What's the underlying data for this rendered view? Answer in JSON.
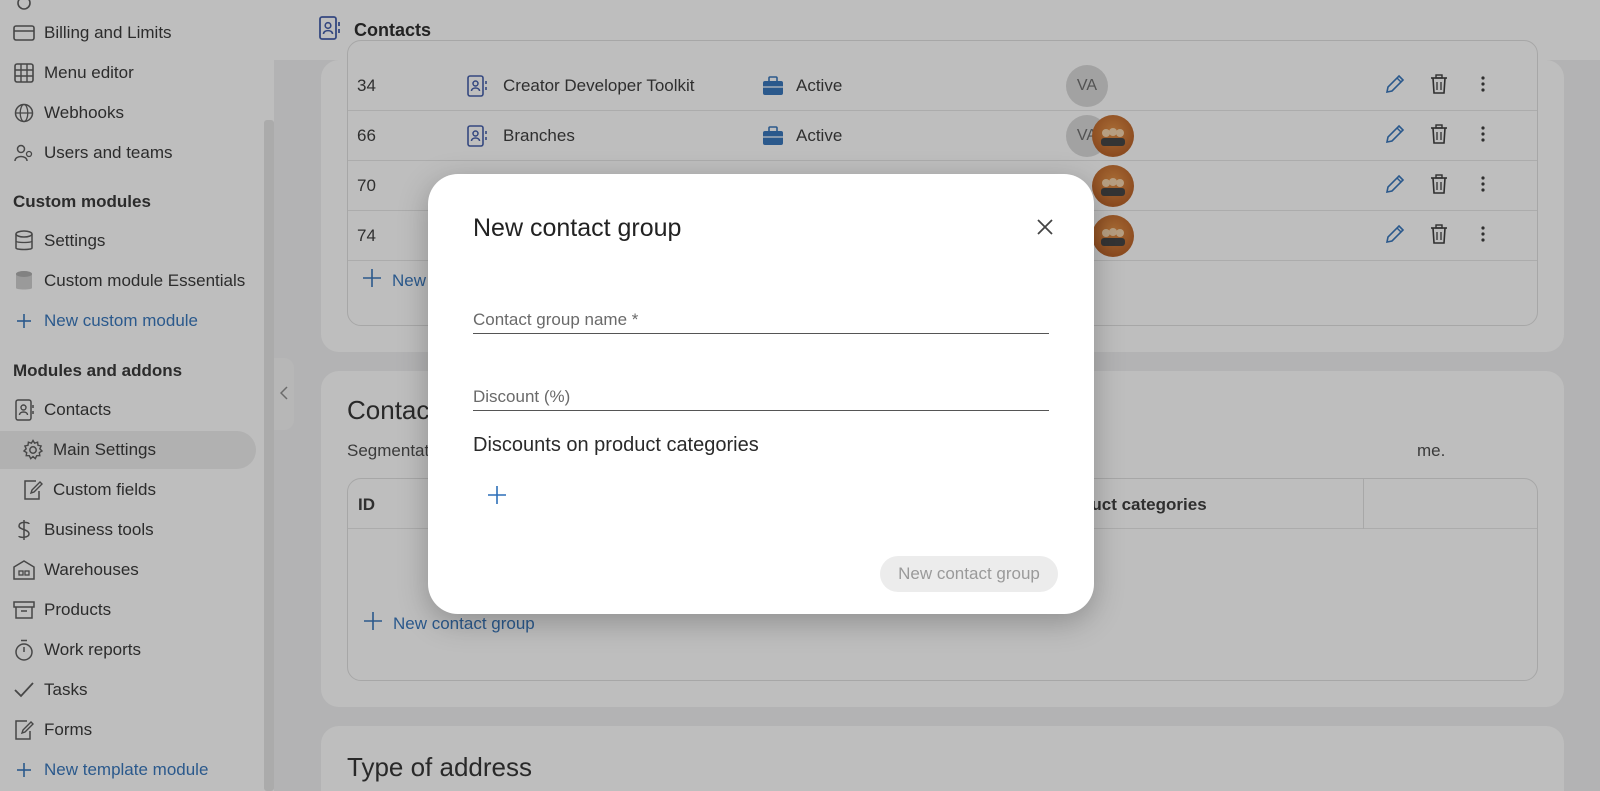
{
  "sidebar": {
    "items_top": [
      {
        "label": "Billing and Limits",
        "icon": "card-icon"
      },
      {
        "label": "Menu editor",
        "icon": "table-icon"
      },
      {
        "label": "Webhooks",
        "icon": "globe-icon"
      },
      {
        "label": "Users and teams",
        "icon": "users-icon"
      }
    ],
    "custom_modules_heading": "Custom modules",
    "custom_modules": [
      {
        "label": "Settings",
        "icon": "database-icon"
      },
      {
        "label": "Custom module Essentials",
        "icon": "database-icon"
      },
      {
        "label": "New custom module",
        "icon": "plus-icon"
      }
    ],
    "addons_heading": "Modules and addons",
    "addons": [
      {
        "label": "Contacts",
        "icon": "contacts-icon"
      },
      {
        "label": "Main Settings",
        "icon": "gear-icon"
      },
      {
        "label": "Custom fields",
        "icon": "form-edit-icon"
      },
      {
        "label": "Business tools",
        "icon": "dollar-icon"
      },
      {
        "label": "Warehouses",
        "icon": "warehouse-icon"
      },
      {
        "label": "Products",
        "icon": "box-icon"
      },
      {
        "label": "Work reports",
        "icon": "stopwatch-icon"
      },
      {
        "label": "Tasks",
        "icon": "checkmark-icon"
      },
      {
        "label": "Forms",
        "icon": "form-edit-icon"
      },
      {
        "label": "New template module",
        "icon": "plus-icon"
      }
    ]
  },
  "topbar": {
    "title": "Contacts",
    "icon": "contacts-icon"
  },
  "types_table": {
    "rows": [
      {
        "id": "34",
        "name": "Creator Developer Toolkit",
        "status": "Active",
        "owner": "VA"
      },
      {
        "id": "66",
        "name": "Branches",
        "status": "Active",
        "owner": "VA"
      },
      {
        "id": "70",
        "name": "",
        "status": "",
        "owner": ""
      },
      {
        "id": "74",
        "name": "",
        "status": "",
        "owner": ""
      }
    ],
    "add_label": "New"
  },
  "groups_section": {
    "title": "Contac",
    "description_start": "Segmentat",
    "description_end": "me.",
    "col_id": "ID",
    "col_categories": "duct categories",
    "add_label": "New contact group"
  },
  "address_section": {
    "title": "Type of address"
  },
  "modal": {
    "title": "New contact group",
    "name_placeholder": "Contact group name *",
    "discount_placeholder": "Discount (%)",
    "categories_label": "Discounts on product categories",
    "submit_label": "New contact group"
  }
}
